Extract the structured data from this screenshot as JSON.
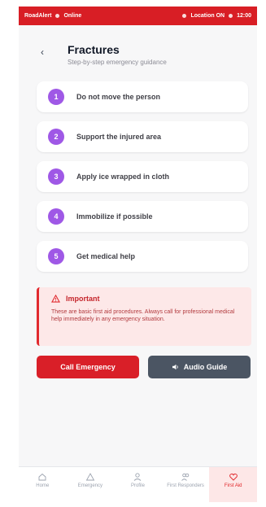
{
  "status_bar": {
    "app_name": "RoadAlert",
    "online_label": "Online",
    "location_label": "Location ON",
    "time": "12:00",
    "bg_color": "#d81e25"
  },
  "header": {
    "back_icon": "chevron-left-icon",
    "title": "Fractures",
    "subtitle": "Step-by-step emergency guidance"
  },
  "steps": [
    {
      "number": "1",
      "label": "Do not move the person"
    },
    {
      "number": "2",
      "label": "Support the injured area"
    },
    {
      "number": "3",
      "label": "Apply ice wrapped in cloth"
    },
    {
      "number": "4",
      "label": "Immobilize if possible"
    },
    {
      "number": "5",
      "label": "Get medical help"
    }
  ],
  "step_badge_color": "#9f58e6",
  "alert": {
    "icon": "warning-triangle-icon",
    "title": "Important",
    "body": "These are basic first aid procedures. Always call for professional medical help immediately in any emergency situation.",
    "accent_color": "#e12a2f"
  },
  "actions": {
    "call_label": "Call Emergency",
    "audio_label": "Audio Guide",
    "audio_icon": "speaker-icon",
    "call_color": "#d91f28",
    "audio_color": "#4b5563"
  },
  "bottom_nav": {
    "items": [
      {
        "label": "Home",
        "icon": "home-icon"
      },
      {
        "label": "Emergency",
        "icon": "alert-icon"
      },
      {
        "label": "Profile",
        "icon": "user-icon"
      },
      {
        "label": "First Responders",
        "icon": "responders-icon"
      },
      {
        "label": "First Aid",
        "icon": "heart-icon"
      }
    ],
    "active": "First Aid"
  }
}
